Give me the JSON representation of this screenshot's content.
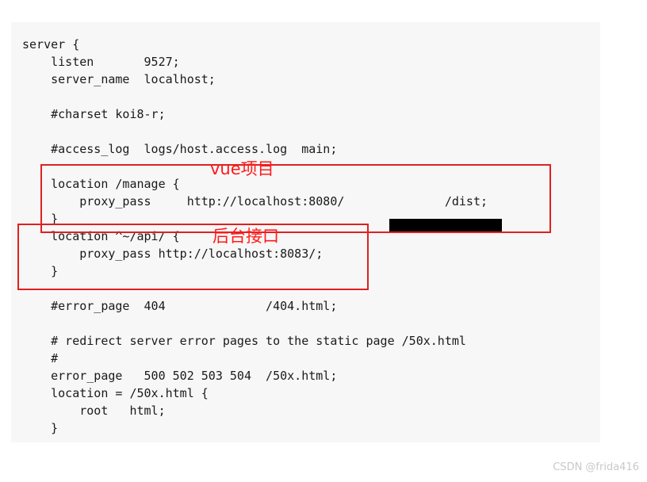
{
  "page": {
    "background_color": "#ffffff"
  },
  "code_panel": {
    "background_color": "#f7f7f7",
    "language": "nginx-conf",
    "text": "server {\n    listen       9527;\n    server_name  localhost;\n\n    #charset koi8-r;\n\n    #access_log  logs/host.access.log  main;\n\n    location /manage {\n        proxy_pass     http://localhost:8080/              /dist;\n    }\n    location ^~/api/ {\n        proxy_pass http://localhost:8083/;\n    }\n\n    #error_page  404              /404.html;\n\n    # redirect server error pages to the static page /50x.html\n    #\n    error_page   500 502 503 504  /50x.html;\n    location = /50x.html {\n        root   html;\n    }\n",
    "lines": [
      "server {",
      "    listen       9527;",
      "    server_name  localhost;",
      "",
      "    #charset koi8-r;",
      "",
      "    #access_log  logs/host.access.log  main;",
      "",
      "    location /manage {",
      "        proxy_pass     http://localhost:8080/              /dist;",
      "    }",
      "    location ^~/api/ {",
      "        proxy_pass http://localhost:8083/;",
      "    }",
      "",
      "    #error_page  404              /404.html;",
      "",
      "    # redirect server error pages to the static page /50x.html",
      "    #",
      "    error_page   500 502 503 504  /50x.html;",
      "    location = /50x.html {",
      "        root   html;",
      "    }"
    ]
  },
  "annotations": {
    "color": "#ff1a1a",
    "box_color": "#e02020",
    "vue_label": "vue项目",
    "api_label": "后台接口"
  },
  "redaction": {
    "color": "#000000"
  },
  "watermark": {
    "text": "CSDN @frida416",
    "color": "#c9c9c9"
  }
}
